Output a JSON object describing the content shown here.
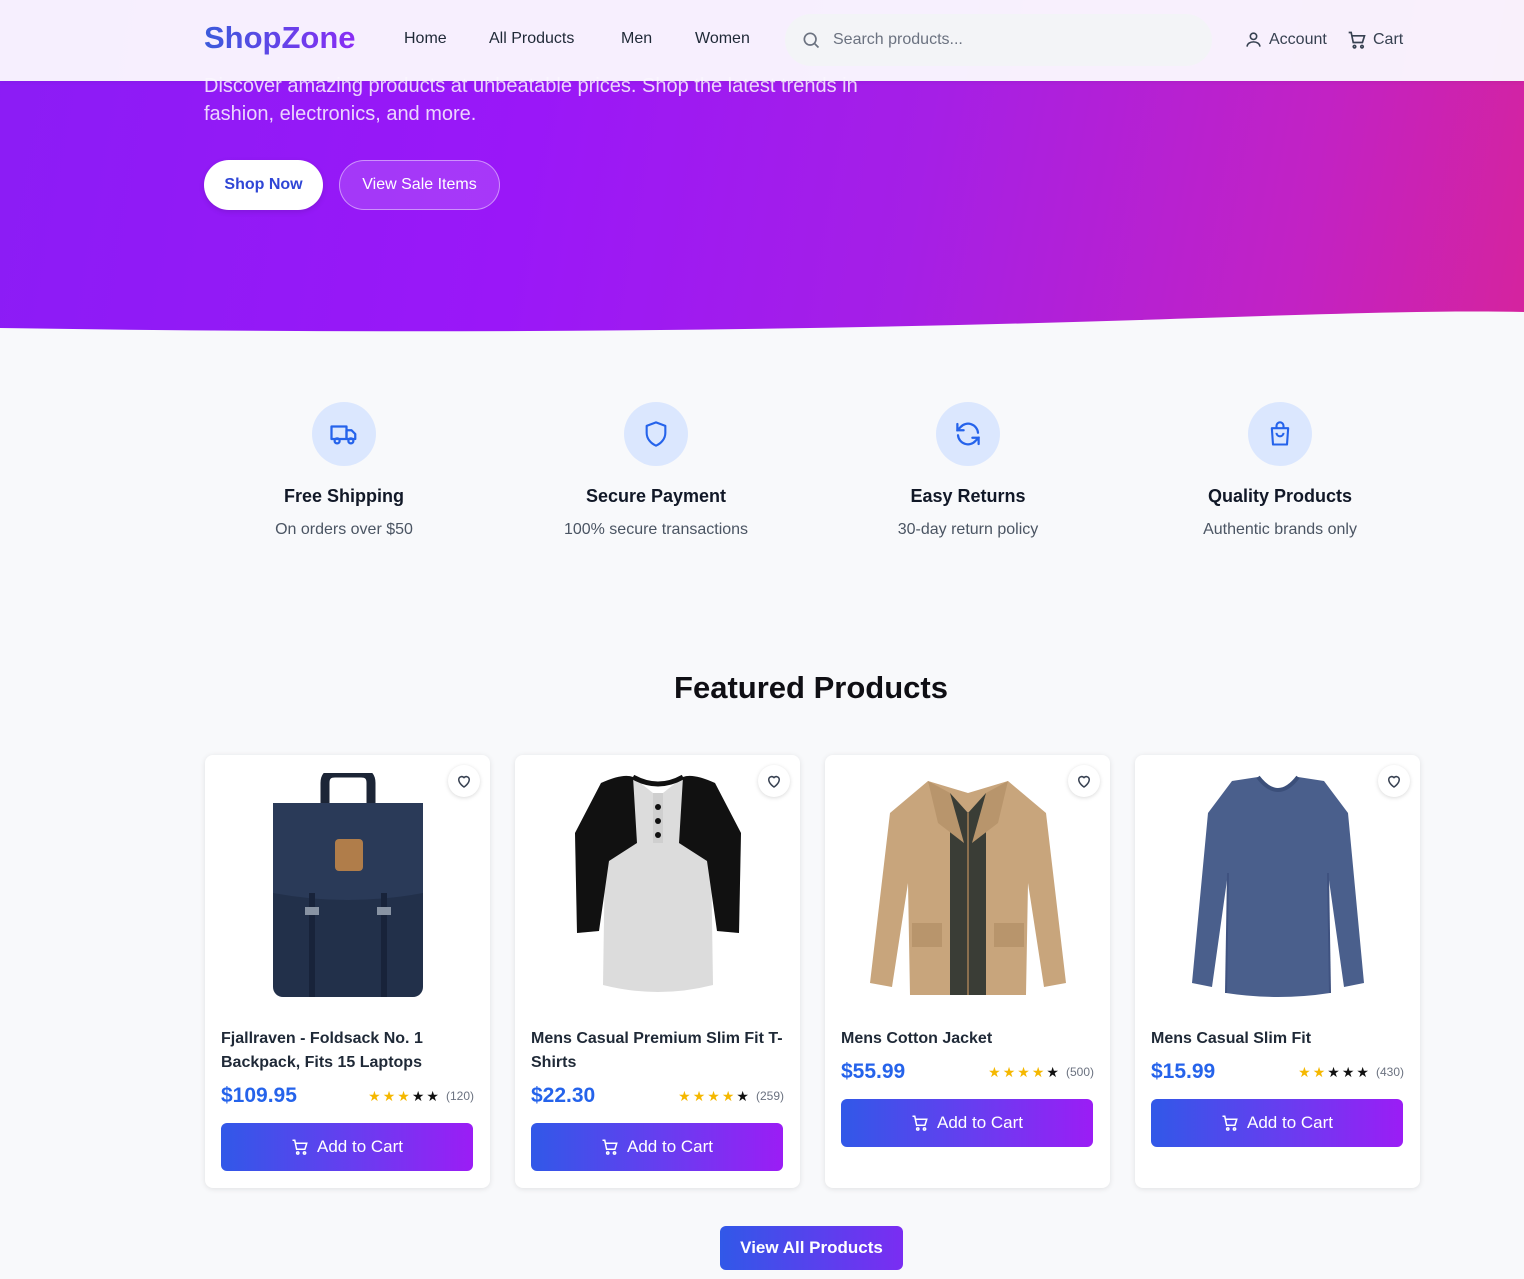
{
  "header": {
    "logo": "ShopZone",
    "nav": [
      "Home",
      "All Products",
      "Men",
      "Women"
    ],
    "search_placeholder": "Search products...",
    "account_label": "Account",
    "cart_label": "Cart"
  },
  "hero": {
    "subtitle": "Discover amazing products at unbeatable prices. Shop the latest trends in fashion, electronics, and more.",
    "shop_now": "Shop Now",
    "view_sale": "View Sale Items"
  },
  "features": [
    {
      "title": "Free Shipping",
      "desc": "On orders over $50",
      "icon": "truck-icon"
    },
    {
      "title": "Secure Payment",
      "desc": "100% secure transactions",
      "icon": "shield-icon"
    },
    {
      "title": "Easy Returns",
      "desc": "30-day return policy",
      "icon": "refresh-icon"
    },
    {
      "title": "Quality Products",
      "desc": "Authentic brands only",
      "icon": "shopping-bag-icon"
    }
  ],
  "featured": {
    "title": "Featured Products",
    "add_to_cart": "Add to Cart",
    "view_all": "View All Products",
    "products": [
      {
        "name": "Fjallraven - Foldsack No. 1 Backpack, Fits 15 Laptops",
        "price": "$109.95",
        "stars": 3,
        "count": "(120)",
        "image": "backpack"
      },
      {
        "name": "Mens Casual Premium Slim Fit T-Shirts",
        "price": "$22.30",
        "stars": 4,
        "count": "(259)",
        "image": "raglan-shirt"
      },
      {
        "name": "Mens Cotton Jacket",
        "price": "$55.99",
        "stars": 4,
        "count": "(500)",
        "image": "jacket"
      },
      {
        "name": "Mens Casual Slim Fit",
        "price": "$15.99",
        "stars": 2,
        "count": "(430)",
        "image": "long-sleeve-shirt"
      }
    ]
  },
  "colors": {
    "accent": "#2563eb",
    "gradient_start": "#8b1cf5",
    "gradient_end": "#d5239e"
  }
}
